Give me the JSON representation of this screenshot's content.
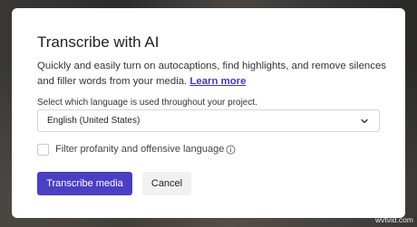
{
  "dialog": {
    "title": "Transcribe with AI",
    "description": "Quickly and easily turn on autocaptions, find highlights, and remove silences and filler words from your media.",
    "learn_more": "Learn more",
    "language_label": "Select which language is used throughout your project.",
    "language_select": {
      "value": "English (United States)",
      "icon": "chevron-down-icon"
    },
    "filter_checkbox": {
      "label": "Filter profanity and offensive language",
      "checked": false,
      "info_icon": "info-icon"
    },
    "primary_button": "Transcribe media",
    "secondary_button": "Cancel"
  },
  "watermark": "wvtvid.com",
  "colors": {
    "primary": "#4b3fc4",
    "link": "#3d3bb8",
    "secondary_bg": "#f1f1f2"
  }
}
